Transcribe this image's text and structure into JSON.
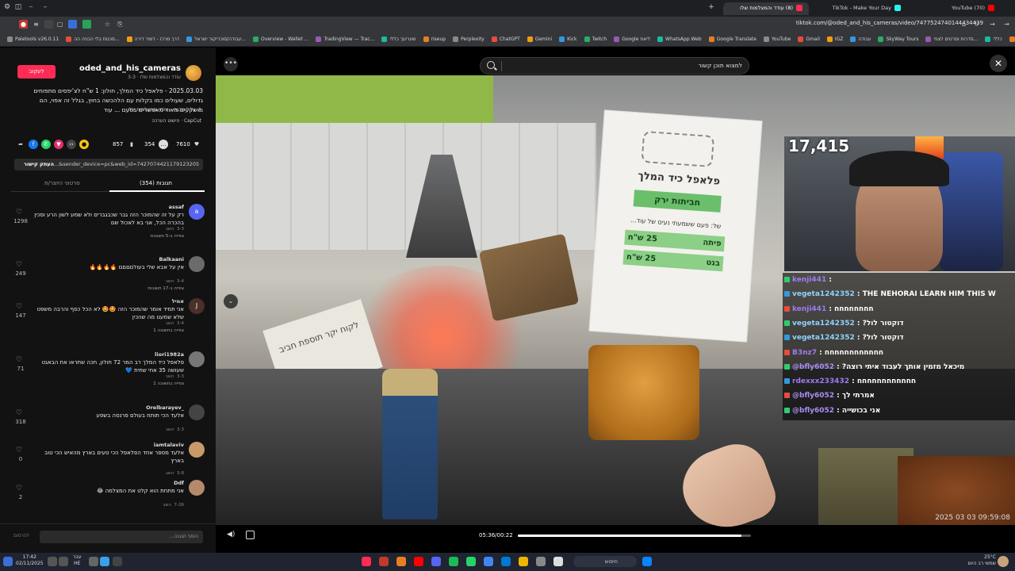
{
  "browser": {
    "tabs": [
      {
        "label": "(70) YouTube",
        "color": "#ff0000"
      },
      {
        "label": "TikTok - Make Your Day",
        "color": "#25f4ee"
      },
      {
        "label": "(8) עודד והמצלמות שלו",
        "color": "#fe2c55"
      }
    ],
    "url": "tiktok.com/@oded_and_his_cameras/video/7477524740144434439",
    "bookmarks": [
      "Paletools v26.0.11",
      "סכנות בלי הכניה הה...",
      "דרך מרכז - דשיר דירה",
      "עבודה/סוכריקור ישראל...",
      "Overview - Wallet ...",
      "TradingView — Trac...",
      "שעריטך כללי",
      "riseup",
      "Perplexity",
      "ChatGPT",
      "Gemini",
      "Kick",
      "Twitch",
      "Google ליאת",
      "WhatsApp Web",
      "Google Translate",
      "YouTube",
      "Gmail",
      "IGZ",
      "עבודה",
      "SkyWay Tours",
      "סדרות וסרטים לצפי...",
      "כללי",
      "תקציבים"
    ]
  },
  "video_info": {
    "follow_label": "לעקוב",
    "author_handle": "oded_and_his_cameras",
    "author_name": "עודד והמצלמות שלו · 3-3",
    "description": "2025.03.03 - פלאפל כיד המלך, חולון: 1 ש\"ח לצ'יפסים מתפוחים גדולים, שעולים כמו בקלות עם הלהכשה בחוץ, בגלל זה אפוי, הם מושקעים מאוד מאפשרים בטעם ... עוד",
    "sound": "צליל מקורי - עודד והמצלמות שלו",
    "capcut": "CapCut · פישוט הערכה",
    "likes": "7610",
    "comments_count": "354",
    "saves": "857",
    "link_text": "...&sender_device=pc&web_id=7427074421179123205",
    "copy_label": "העתק קישור",
    "tab_comments": "תגובות (354)",
    "tab_creator": "סרטוני היוצר/ת"
  },
  "comments": [
    {
      "user": "assaf",
      "text": "רק על זה שהמוכר הזה גבר שכבגברים ולא שמע לשון הרע וסכין בהכרה הכל, אני בא לאכול שם",
      "meta": "3-3",
      "reply": "השב",
      "views": "צפייה ב-5 תשובות",
      "likes": "1298",
      "avatar_color": "#5865f2",
      "avatar_letter": "a"
    },
    {
      "user": "Balkaani",
      "text": "אין על אבא שלי בעולםםםם 🔥🔥🔥🔥",
      "meta": "3-4",
      "reply": "השב",
      "views": "צפייה ב-17 תשובות",
      "likes": "249",
      "avatar_color": "#6b6b6b",
      "avatar_letter": ""
    },
    {
      "user": "אמיל",
      "text": "אני תמיד אומר שהמוכר הזה 🤩🤩 לא הכל כסף והרבה משפט שלא שמענו מה שהכין",
      "meta": "3-4",
      "reply": "השב",
      "views": "צפייה בתשובה 1",
      "likes": "147",
      "avatar_color": "#4a2f2a",
      "avatar_letter": "J"
    },
    {
      "user": "liori1982a",
      "text": "פלאפל כיד המלך רב המר 72 חולון, חכה שתראו את הבאגט שעושה 35 אחי שתית 💙",
      "meta": "3-3",
      "reply": "השב",
      "views": "צפייה בתשובה 1",
      "likes": "71",
      "avatar_color": "#777777",
      "avatar_letter": ""
    },
    {
      "user": "Orelbarayev_",
      "text": "אלעד הכי תותח בעולם פרנסה בשפע",
      "meta": "3-3",
      "reply": "השב",
      "views": "",
      "likes": "318",
      "avatar_color": "#444444",
      "avatar_letter": ""
    },
    {
      "user": "iamtalaviv",
      "text": "אלעד מספר אחד הפלאפל הכי טעים בארץ מהאיש הכי טוב בארץ",
      "meta": "3-8",
      "reply": "השב",
      "views": "",
      "likes": "0",
      "avatar_color": "#c89a6a",
      "avatar_letter": ""
    },
    {
      "user": "Ddf",
      "text": "אני מתחת הוא קלט את המצלמה 😂",
      "meta": "7-26",
      "reply": "השב",
      "views": "",
      "likes": "2",
      "avatar_color": "#b58a6a",
      "avatar_letter": ""
    }
  ],
  "comment_input": {
    "placeholder": "הוסף תגובה...",
    "post_label": "לפרסום"
  },
  "player": {
    "search_placeholder": "למצוא תוכן קשור",
    "time": "05:36/00:22",
    "progress": 0.96,
    "timestamp": "2025 03 03  09:59:08",
    "sign_title": "פלאפל כיד המלך",
    "sign_green": "חביתות ירק",
    "sign_small": "של: פעם ששמעתי נעים של עוד...",
    "sign_price1_item": "פיתה",
    "sign_price1_val": "25 ש\"ח",
    "sign_price2_item": "בגט",
    "sign_price2_val": "25 ש\"ח",
    "sign_small2": "לקוח יקר תוספת חביב"
  },
  "stream": {
    "viewers": "17,415",
    "chat": [
      {
        "user": "kenji441",
        "msg": "",
        "ucolor": "#9d7cf0"
      },
      {
        "user": "vegeta1242352",
        "msg": "THE NEHORAI LEARN HIM THIS W",
        "ucolor": "#8fd3ff"
      },
      {
        "user": "kenji441",
        "msg": "חחחחחחחח",
        "ucolor": "#9d7cf0"
      },
      {
        "user": "vegeta1242352",
        "msg": "דוקטור לול?",
        "ucolor": "#8fd3ff"
      },
      {
        "user": "vegeta1242352",
        "msg": "דוקטור לול?",
        "ucolor": "#8fd3ff"
      },
      {
        "user": "B3nz7",
        "msg": "חחחחחחחחחחחח",
        "ucolor": "#9d7cf0"
      },
      {
        "user": "@bfly6052",
        "msg": "מיכאל מזמין אותך לעבוד איתי רוצה?",
        "ucolor": "#a98cf5"
      },
      {
        "user": "rdexxx233432",
        "msg": "חחחחחחחחחחחח",
        "ucolor": "#9d7cf0"
      },
      {
        "user": "@bfly6052",
        "msg": "אמרתי לך",
        "ucolor": "#a98cf5"
      },
      {
        "user": "@bfly6052",
        "msg": "אני בכושייה",
        "ucolor": "#a98cf5"
      }
    ]
  },
  "taskbar": {
    "time": "17:42",
    "date": "02/11/2025",
    "lang1": "עבר",
    "lang2": "HE",
    "search": "חיפוש",
    "temp": "25°C",
    "weather": "שמשי רב היום"
  },
  "colors": {
    "accent": "#fe2c55",
    "bg": "#121212"
  }
}
